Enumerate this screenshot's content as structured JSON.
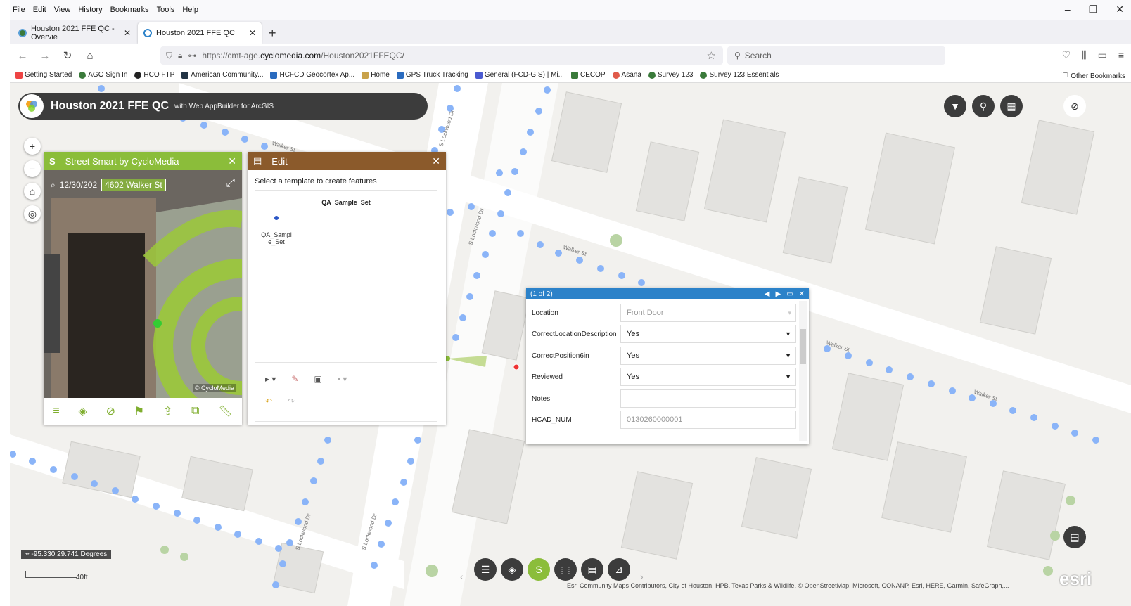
{
  "menu": [
    "File",
    "Edit",
    "View",
    "History",
    "Bookmarks",
    "Tools",
    "Help"
  ],
  "window_controls": {
    "minimize": "–",
    "restore": "❐",
    "close": "✕"
  },
  "tabs": [
    {
      "title": "Houston 2021 FFE QC - Overvie",
      "close": "✕"
    },
    {
      "title": "Houston 2021 FFE QC",
      "close": "✕"
    }
  ],
  "new_tab_label": "+",
  "url": {
    "prefix": "https://cmt-age.",
    "host": "cyclomedia.com",
    "path": "/Houston2021FFEQC/"
  },
  "search_placeholder": "Search",
  "bookmarks": [
    "Getting Started",
    "AGO Sign In",
    "HCO FTP",
    "American Community...",
    "HCFCD Geocortex Ap...",
    "Home",
    "GPS Truck Tracking",
    "General (FCD-GIS) | Mi...",
    "CECOP",
    "Asana",
    "Survey 123",
    "Survey 123 Essentials"
  ],
  "other_bookmarks": "Other Bookmarks",
  "app": {
    "title": "Houston 2021 FFE QC",
    "subtitle": "with Web AppBuilder for ArcGIS"
  },
  "street_smart": {
    "badge": "S",
    "title": "Street Smart by CycloMedia",
    "date": "12/30/202",
    "address": "4602 Walker St",
    "copyright": "© CycloMedia"
  },
  "edit": {
    "title": "Edit",
    "instruction": "Select a template to create features",
    "template_group": "QA_Sample_Set",
    "template_item": "QA_Sampl e_Set"
  },
  "popup": {
    "counter": "(1 of 2)",
    "rows": [
      {
        "label": "Location",
        "value": "Front Door",
        "readonly": true
      },
      {
        "label": "CorrectLocationDescription",
        "value": "Yes"
      },
      {
        "label": "CorrectPosition6in",
        "value": "Yes"
      },
      {
        "label": "Reviewed",
        "value": "Yes"
      },
      {
        "label": "Notes",
        "value": ""
      },
      {
        "label": "HCAD_NUM",
        "value": "0130260000001",
        "readonly": true
      }
    ]
  },
  "coordinates": "-95.330 29.741 Degrees",
  "scale": "40ft",
  "attribution": "Esri Community Maps Contributors, City of Houston, HPB, Texas Parks & Wildlife, © OpenStreetMap, Microsoft, CONANP, Esri, HERE, Garmin, SafeGraph,...",
  "esri_logo": "esri",
  "street_labels": [
    "Walker St",
    "Walker St",
    "Walker St",
    "Walker St",
    "S Lockwood Dr",
    "S Lockwood Dr",
    "S Lockwood Dr",
    "S Lockwood Dr"
  ],
  "colors": {
    "street_smart": "#8bbd3a",
    "edit": "#8b5a2b",
    "popup": "#2c82c9",
    "header": "#3c3c3c",
    "dots": "#8ab4f8"
  }
}
